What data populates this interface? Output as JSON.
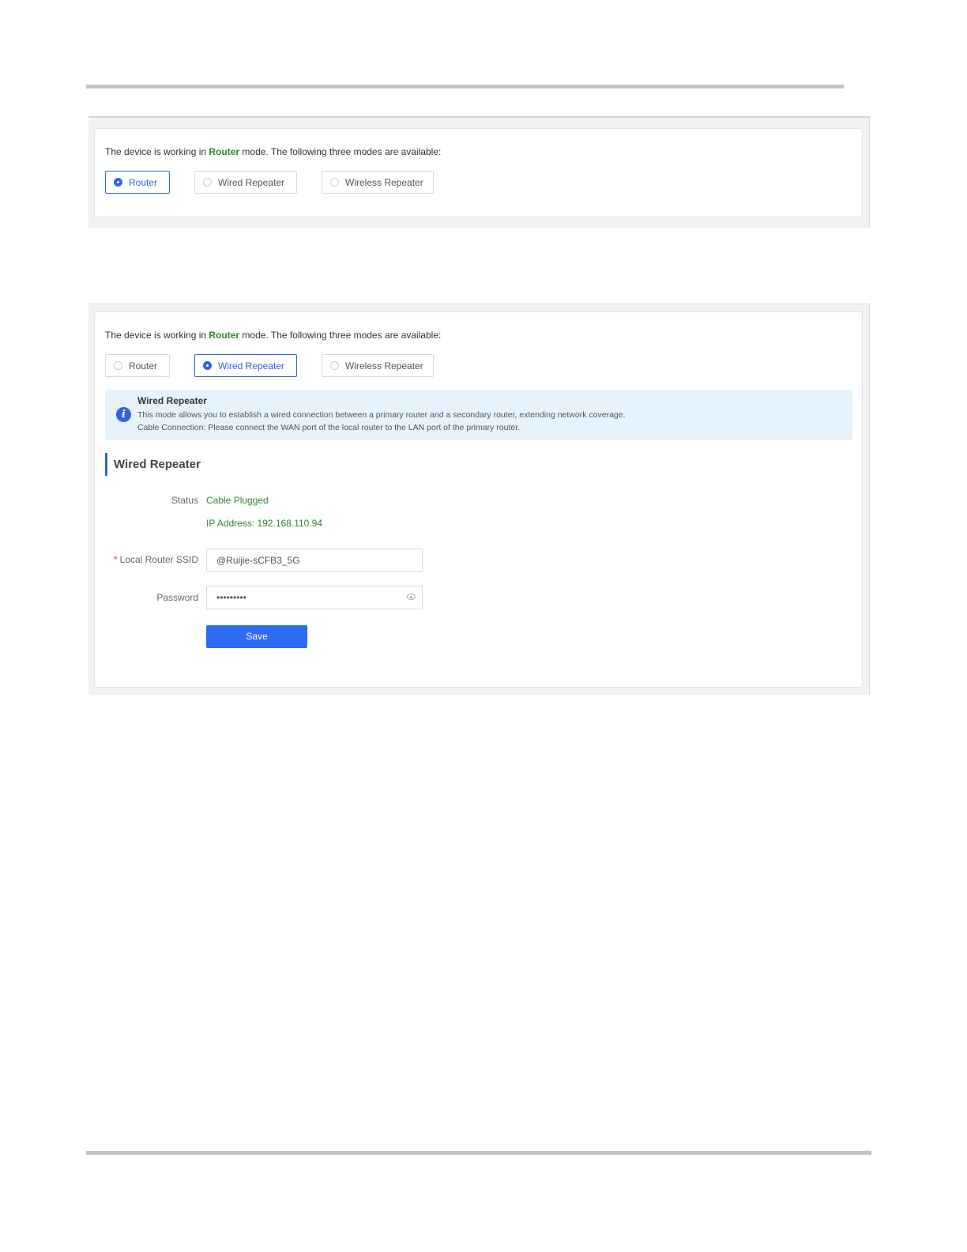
{
  "screenshot1": {
    "intro": {
      "before": "The device is working in ",
      "mode": "Router",
      "after": " mode. The following three modes are available:"
    },
    "options": [
      {
        "label": "Router",
        "selected": true
      },
      {
        "label": "Wired Repeater",
        "selected": false
      },
      {
        "label": "Wireless Repeater",
        "selected": false
      }
    ]
  },
  "screenshot2": {
    "intro": {
      "before": "The device is working in ",
      "mode": "Router",
      "after": " mode. The following three modes are available:"
    },
    "options": [
      {
        "label": "Router",
        "selected": false
      },
      {
        "label": "Wired Repeater",
        "selected": true
      },
      {
        "label": "Wireless Repeater",
        "selected": false
      }
    ],
    "alert": {
      "title": "Wired Repeater",
      "line1": "This mode allows you to establish a wired connection between a primary router and a secondary router, extending network coverage.",
      "line2": "Cable Connection: Please connect the WAN port of the local router to the LAN port of the primary router."
    },
    "section_title": "Wired Repeater",
    "status": {
      "label": "Status",
      "value": "Cable Plugged",
      "ip": "IP Address: 192.168.110.94"
    },
    "ssid": {
      "required_mark": "*",
      "label": "Local Router SSID",
      "value": "@Ruijie-sCFB3_5G"
    },
    "password": {
      "label": "Password",
      "value": "•••••••••"
    },
    "save_label": "Save"
  },
  "colors": {
    "accent": "#2f63e8",
    "success": "#2a8a2a",
    "alert_bg": "#e6f2fc",
    "required": "#e03c3c"
  }
}
